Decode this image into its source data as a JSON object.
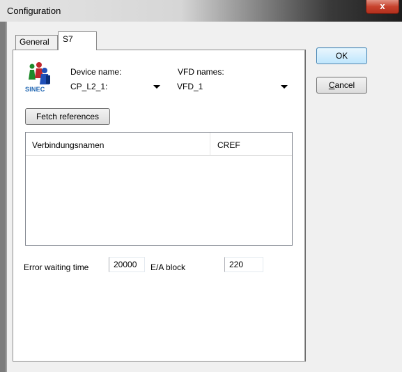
{
  "window": {
    "title": "Configuration",
    "close_glyph": "x"
  },
  "tabs": {
    "general": "General",
    "s7": "S7"
  },
  "buttons": {
    "ok": "OK",
    "cancel_underlined": "C",
    "cancel_rest": "ancel"
  },
  "logo": {
    "text": "SINEC",
    "icon": "network-people-icon"
  },
  "device": {
    "label": "Device name:",
    "value": "CP_L2_1:"
  },
  "vfd": {
    "label": "VFD names:",
    "value": "VFD_1"
  },
  "fetch": {
    "label": "Fetch references"
  },
  "list": {
    "columns": [
      "Verbindungsnamen",
      "CREF"
    ],
    "rows": []
  },
  "error_wait": {
    "label": "Error waiting time",
    "value": "20000"
  },
  "ea_block": {
    "label": "E/A block",
    "value": "220"
  },
  "colors": {
    "close": "#c7422d",
    "logo_blue": "#1a62b0",
    "ok_border": "#3c7fb1"
  }
}
